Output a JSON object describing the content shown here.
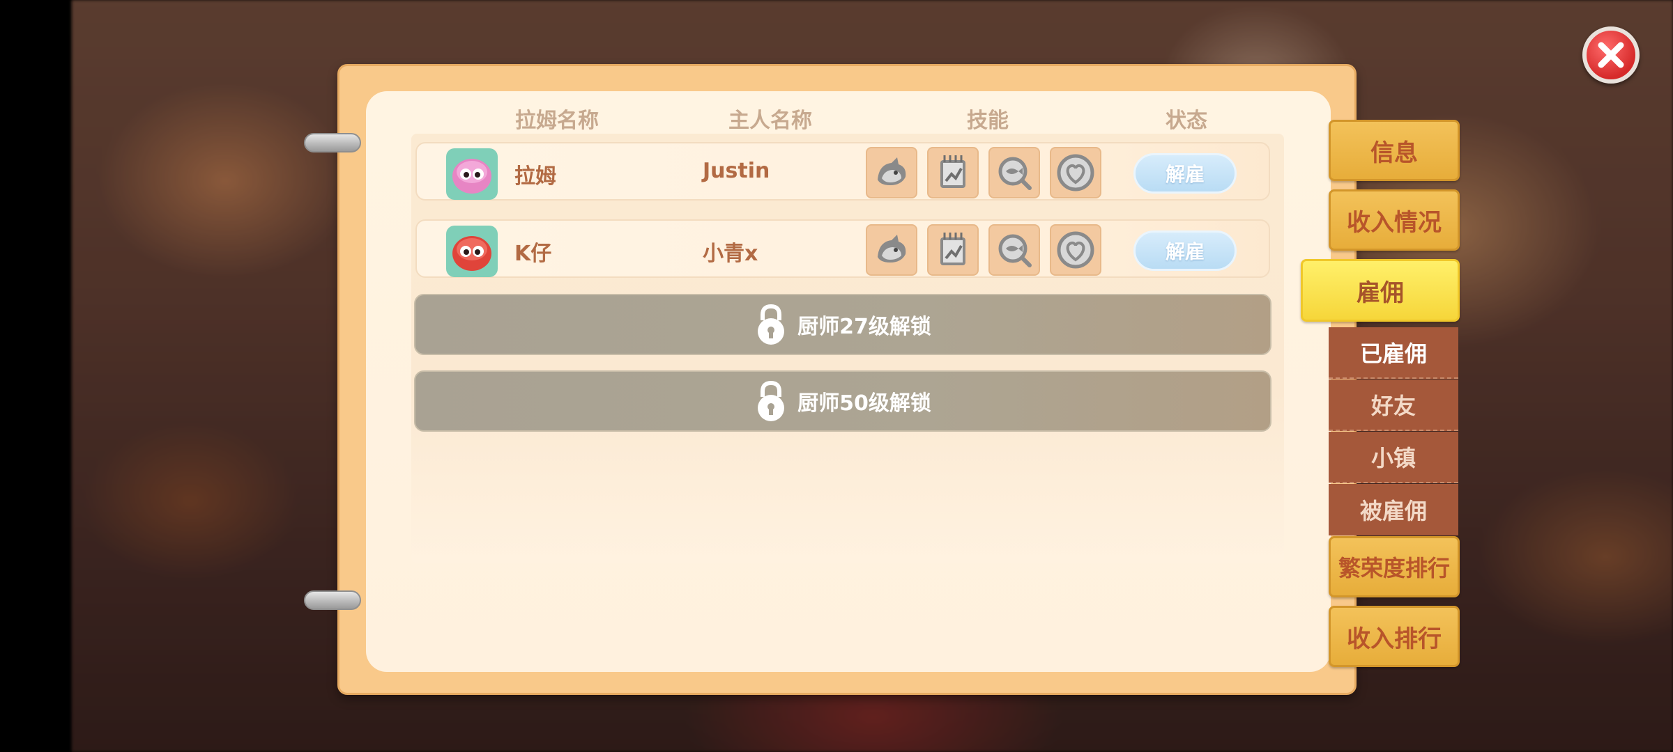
{
  "headers": {
    "pet_name": "拉姆名称",
    "owner_name": "主人名称",
    "skills": "技能",
    "status": "状态"
  },
  "rows": [
    {
      "name": "拉姆",
      "owner": "Justin",
      "action": "解雇",
      "avatar_color": "#e785c4"
    },
    {
      "name": "K仔",
      "owner": "小青x",
      "action": "解雇",
      "avatar_color": "#e0443a"
    }
  ],
  "locked_slots": [
    {
      "label": "厨师27级解锁"
    },
    {
      "label": "厨师50级解锁"
    }
  ],
  "tabs": [
    {
      "label": "信息"
    },
    {
      "label": "收入情况"
    },
    {
      "label": "雇佣",
      "active": true
    },
    {
      "label": "繁荣度排行"
    },
    {
      "label": "收入排行"
    }
  ],
  "subtabs": [
    {
      "label": "已雇佣",
      "selected": true
    },
    {
      "label": "好友"
    },
    {
      "label": "小镇"
    },
    {
      "label": "被雇佣"
    }
  ],
  "colors": {
    "tab_gold": "#e7ad3a",
    "tab_active": "#f6d63a",
    "subtab_brown": "#a5583a",
    "text_brown": "#b26a43",
    "close_red": "#d62a2a"
  },
  "icons": [
    "close-icon",
    "wolf-skill-icon",
    "chart-notebook-skill-icon",
    "fish-magnifier-skill-icon",
    "heart-skill-icon",
    "lock-icon"
  ]
}
